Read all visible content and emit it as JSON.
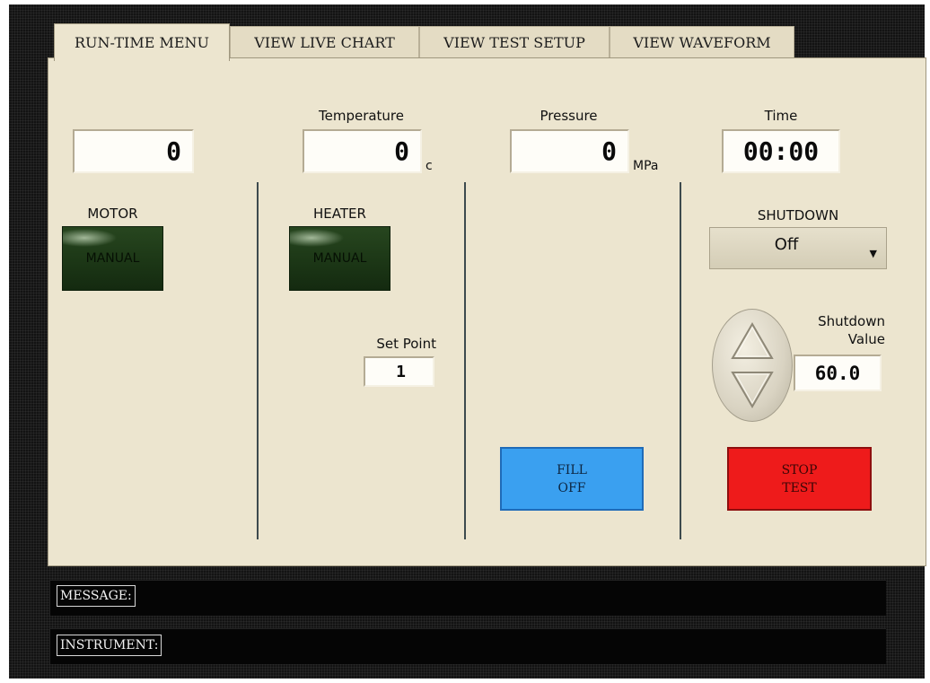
{
  "tabs": [
    {
      "label": "RUN-TIME MENU",
      "active": true
    },
    {
      "label": "VIEW LIVE CHART",
      "active": false
    },
    {
      "label": "VIEW TEST SETUP",
      "active": false
    },
    {
      "label": "VIEW WAVEFORM",
      "active": false
    }
  ],
  "readouts": {
    "speed": {
      "value": "0"
    },
    "temperature": {
      "label": "Temperature",
      "value": "0",
      "unit": "c"
    },
    "pressure": {
      "label": "Pressure",
      "value": "0",
      "unit": "MPa"
    },
    "time": {
      "label": "Time",
      "value": "00:00"
    }
  },
  "motor": {
    "label": "MOTOR",
    "button": "MANUAL"
  },
  "heater": {
    "label": "HEATER",
    "button": "MANUAL",
    "setpoint_label": "Set Point",
    "setpoint_value": "1"
  },
  "fill_button": {
    "line1": "FILL",
    "line2": "OFF"
  },
  "shutdown": {
    "label": "SHUTDOWN",
    "selected": "Off",
    "value_label_line1": "Shutdown",
    "value_label_line2": "Value",
    "value": "60.0"
  },
  "stop_button": {
    "line1": "STOP",
    "line2": "TEST"
  },
  "status": {
    "message_label": "MESSAGE:",
    "instrument_label": "INSTRUMENT:"
  },
  "colors": {
    "panel": "#ece5cf",
    "green_button": "#1c3716",
    "fill_button": "#3aa0f0",
    "stop_button": "#ee1b1b",
    "background": "#131313"
  }
}
